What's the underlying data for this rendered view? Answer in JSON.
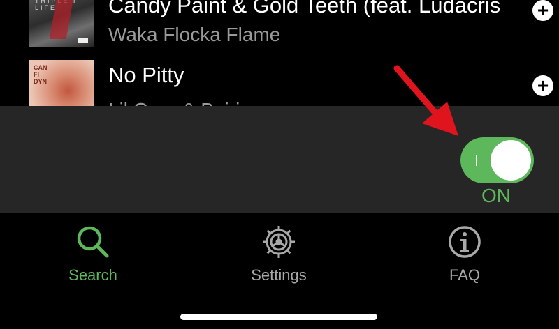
{
  "tracks": [
    {
      "title": "Candy Paint & Gold Teeth (feat. Ludacris",
      "artist": "Waka Flocka Flame",
      "art_label": "TRIPLE F LIFE"
    },
    {
      "title": "No Pitty",
      "artist": "Lil Gnar & Bairi",
      "art_label": "CAN FI DYN"
    }
  ],
  "add_icon": "plus-icon",
  "toggle": {
    "label": "ON",
    "state": "on",
    "color": "#5cb85a"
  },
  "tabs": [
    {
      "label": "Search",
      "icon": "search-icon",
      "active": true,
      "color": "#5cb85a"
    },
    {
      "label": "Settings",
      "icon": "gear-icon",
      "active": false,
      "color": "#a8a8a8"
    },
    {
      "label": "FAQ",
      "icon": "info-icon",
      "active": false,
      "color": "#a8a8a8"
    }
  ],
  "colors": {
    "accent": "#5cb85a",
    "panel": "#262626",
    "annotation_arrow": "#e0141c"
  }
}
